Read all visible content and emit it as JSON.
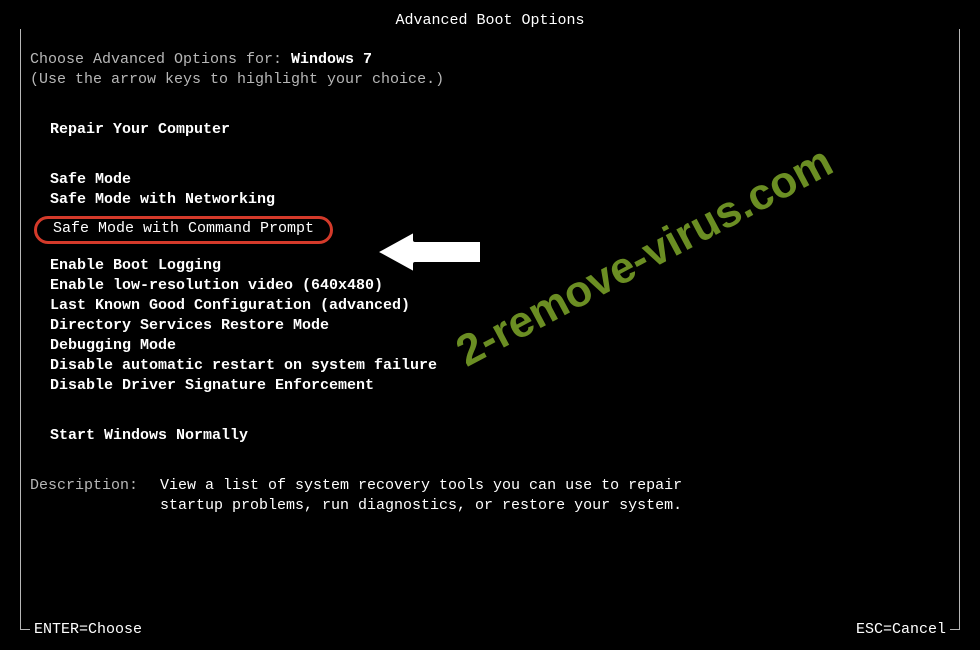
{
  "title": "Advanced Boot Options",
  "choose_label": "Choose Advanced Options for: ",
  "os_name": "Windows 7",
  "hint_arrow": "(Use the arrow keys to highlight your choice.)",
  "groups": {
    "repair": "Repair Your Computer",
    "safe1": "Safe Mode",
    "safe2": "Safe Mode with Networking",
    "safe3": "Safe Mode with Command Prompt",
    "g1": "Enable Boot Logging",
    "g2": "Enable low-resolution video (640x480)",
    "g3": "Last Known Good Configuration (advanced)",
    "g4": "Directory Services Restore Mode",
    "g5": "Debugging Mode",
    "g6": "Disable automatic restart on system failure",
    "g7": "Disable Driver Signature Enforcement",
    "start": "Start Windows Normally"
  },
  "desc_label": "Description:",
  "desc_line1": "View a list of system recovery tools you can use to repair",
  "desc_line2": "startup problems, run diagnostics, or restore your system.",
  "hint_enter": "ENTER=Choose",
  "hint_esc": "ESC=Cancel",
  "watermark": "2-remove-virus.com"
}
